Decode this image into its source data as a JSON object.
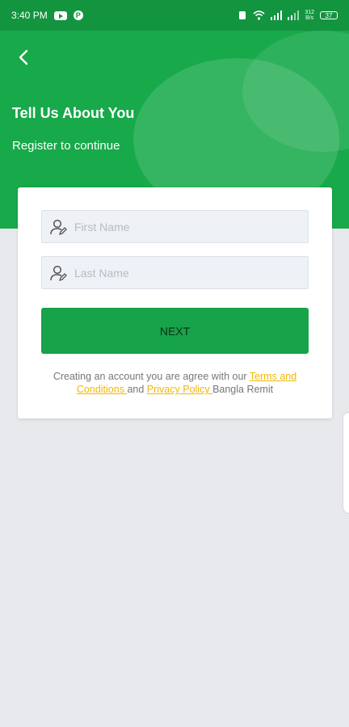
{
  "status_bar": {
    "time": "3:40 PM",
    "net_speed_value": "312",
    "net_speed_unit": "B/s",
    "battery": "37"
  },
  "header": {
    "title": "Tell Us About You",
    "subtitle": "Register to continue"
  },
  "form": {
    "first_name_placeholder": "First Name",
    "last_name_placeholder": "Last Name",
    "first_name_value": "",
    "last_name_value": "",
    "next_label": "NEXT"
  },
  "terms": {
    "prefix": "Creating an account you are agree with our ",
    "terms_link": "Terms and Conditions ",
    "middle": " and ",
    "privacy_link": "Privacy Policy ",
    "suffix": " Bangla Remit"
  },
  "colors": {
    "brand_green": "#17a94a",
    "button_green": "#16a34a",
    "link_yellow": "#f2b705"
  }
}
